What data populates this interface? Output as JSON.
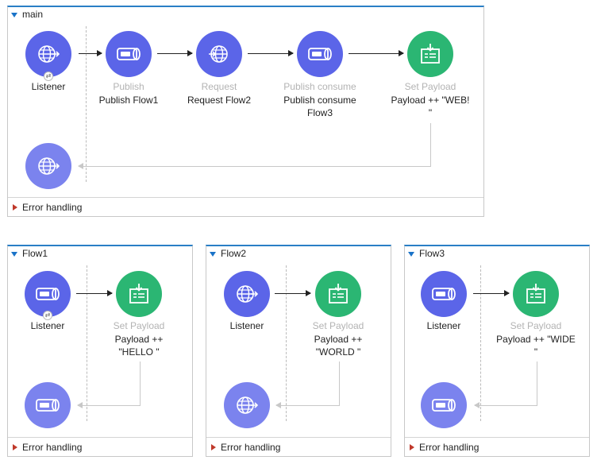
{
  "main": {
    "title": "main",
    "nodes": {
      "listener": {
        "title": "Listener",
        "icon": "globe-icon"
      },
      "publish": {
        "type": "Publish",
        "name": "Publish Flow1",
        "icon": "connector-icon"
      },
      "request": {
        "type": "Request",
        "name": "Request Flow2",
        "icon": "globe-icon"
      },
      "publish_consume": {
        "type": "Publish consume",
        "name_line1": "Publish consume",
        "name_line2": "Flow3",
        "icon": "connector-icon"
      },
      "set_payload": {
        "type": "Set Payload",
        "name_line1": "Payload ++ \"WEB!",
        "name_line2": "\"",
        "icon": "set-payload-icon"
      }
    },
    "error_handling": "Error handling"
  },
  "flow1": {
    "title": "Flow1",
    "listener": "Listener",
    "set_payload_type": "Set Payload",
    "set_payload_line1": "Payload ++",
    "set_payload_line2": "\"HELLO \"",
    "error_handling": "Error handling"
  },
  "flow2": {
    "title": "Flow2",
    "listener": "Listener",
    "set_payload_type": "Set Payload",
    "set_payload_line1": "Payload ++",
    "set_payload_line2": "\"WORLD \"",
    "error_handling": "Error handling"
  },
  "flow3": {
    "title": "Flow3",
    "listener": "Listener",
    "set_payload_type": "Set Payload",
    "set_payload_line1": "Payload ++ \"WIDE",
    "set_payload_line2": "\"",
    "error_handling": "Error handling"
  },
  "colors": {
    "accent": "#2a7fc6",
    "http_node": "#5b65e8",
    "response_node": "#7b83ee",
    "set_payload_node": "#2bb673",
    "error_triangle": "#c0392b"
  }
}
